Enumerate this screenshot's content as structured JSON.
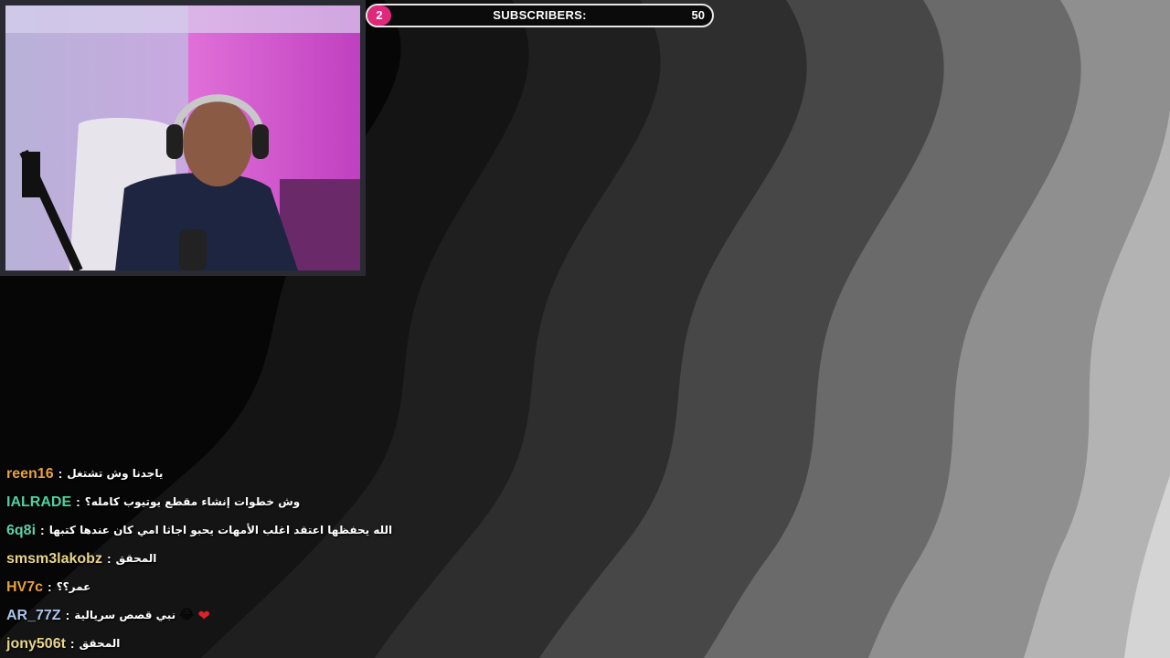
{
  "colors": {
    "accent": "#e0287a",
    "bar_border": "#e8e8e8",
    "heart": "#e0202a"
  },
  "subscriber_goal": {
    "current": "2",
    "label": "SUBSCRIBERS:",
    "goal": "50",
    "progress_fraction": 0.04
  },
  "webcam": {
    "description_icon": "webcam-feed"
  },
  "chat": {
    "messages": [
      {
        "user": "reen16",
        "color": "#e8a13a",
        "text": "ياجدنا وش تشتغل",
        "emoji": "",
        "heart": false
      },
      {
        "user": "IALRADE",
        "color": "#4fd1a0",
        "text": "وش خطوات إنشاء مقطع يوتيوب كامله؟",
        "emoji": "",
        "heart": false
      },
      {
        "user": "6q8i",
        "color": "#5fd0a8",
        "text": "الله يحفظها اعتقد اغلب الأمهات يحبو اجاثا امي كان عندها كتبها",
        "emoji": "",
        "heart": false
      },
      {
        "user": "smsm3lakobz",
        "color": "#e8d48a",
        "text": "المحقق",
        "emoji": "",
        "heart": false
      },
      {
        "user": "HV7c",
        "color": "#e8a13a",
        "text": "عمر؟؟",
        "emoji": "",
        "heart": false
      },
      {
        "user": "AR_77Z",
        "color": "#a9c6e8",
        "text": "نبي قصص سريالية",
        "emoji": "😂",
        "heart": true
      },
      {
        "user": "jony506t",
        "color": "#e8d48a",
        "text": "المحقق",
        "emoji": "",
        "heart": false
      }
    ]
  }
}
